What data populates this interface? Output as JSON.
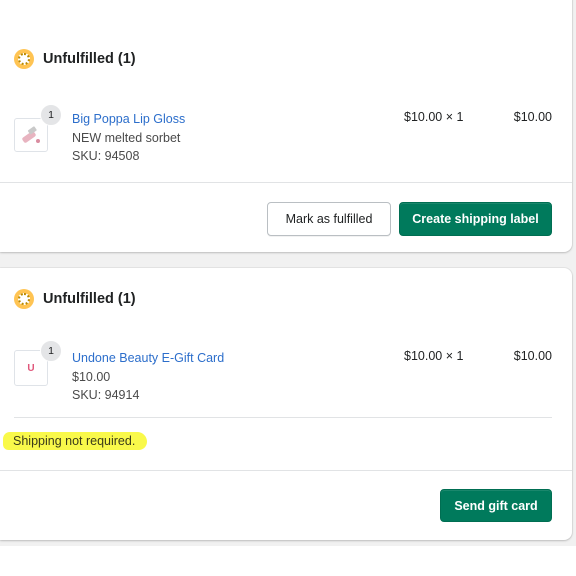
{
  "orders": [
    {
      "status": "Unfulfilled (1)",
      "status_icon": "unfulfilled-status-icon",
      "item": {
        "quantity": "1",
        "name": "Big Poppa Lip Gloss",
        "variant": "NEW melted sorbet",
        "sku": "SKU: 94508",
        "unit_price": "$10.00 × 1",
        "total": "$10.00",
        "thumbnail_icon": "lip-gloss-thumbnail"
      },
      "actions": {
        "secondary_label": "Mark as fulfilled",
        "primary_label": "Create shipping label"
      }
    },
    {
      "status": "Unfulfilled (1)",
      "status_icon": "unfulfilled-status-icon",
      "item": {
        "quantity": "1",
        "name": "Undone Beauty E-Gift Card",
        "variant": "$10.00",
        "sku": "SKU: 94914",
        "unit_price": "$10.00 × 1",
        "total": "$10.00",
        "thumbnail_icon": "gift-card-thumbnail",
        "thumbnail_text": "U"
      },
      "note": "Shipping not required.",
      "actions": {
        "primary_label": "Send gift card"
      }
    }
  ],
  "colors": {
    "link": "#2c6ecb",
    "primary_button": "#007a5c",
    "status_badge": "#ffc453",
    "highlight": "#f9f94a"
  }
}
